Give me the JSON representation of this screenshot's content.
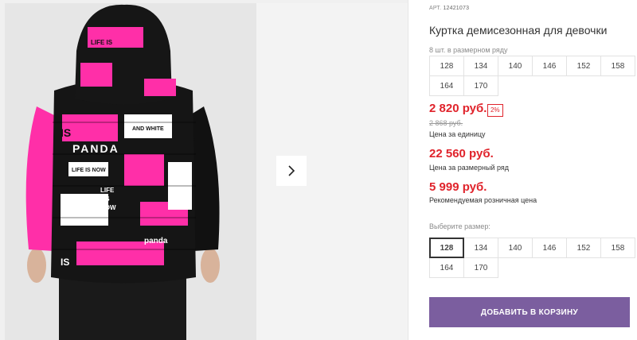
{
  "product": {
    "sku_label": "АРТ.",
    "sku_code": "12421073",
    "title": "Куртка демисезонная для девочки",
    "image_alt": "Куртка с принтом PANDA, вид сзади"
  },
  "size_row": {
    "label": "8 шт. в размерном ряду",
    "sizes": [
      "128",
      "134",
      "140",
      "146",
      "152",
      "158",
      "164",
      "170"
    ]
  },
  "prices": {
    "unit_price": "2 820 руб.",
    "discount_badge": "2%",
    "old_price": "2 868 руб.",
    "unit_caption": "Цена за единицу",
    "row_price": "22 560 руб.",
    "row_caption": "Цена за размерный ряд",
    "retail_price": "5 999 руб.",
    "retail_caption": "Рекомендуемая розничная цена"
  },
  "size_picker": {
    "label": "Выберите размер:",
    "sizes": [
      "128",
      "134",
      "140",
      "146",
      "152",
      "158",
      "164",
      "170"
    ],
    "selected": "128"
  },
  "cart": {
    "add_label": "ДОБАВИТЬ В КОРЗИНУ"
  },
  "colors": {
    "price_red": "#e0232b",
    "button_purple": "#7b5e9f",
    "jacket_pink": "#ff2fa8"
  },
  "icons": {
    "next": "chevron-right-icon"
  }
}
